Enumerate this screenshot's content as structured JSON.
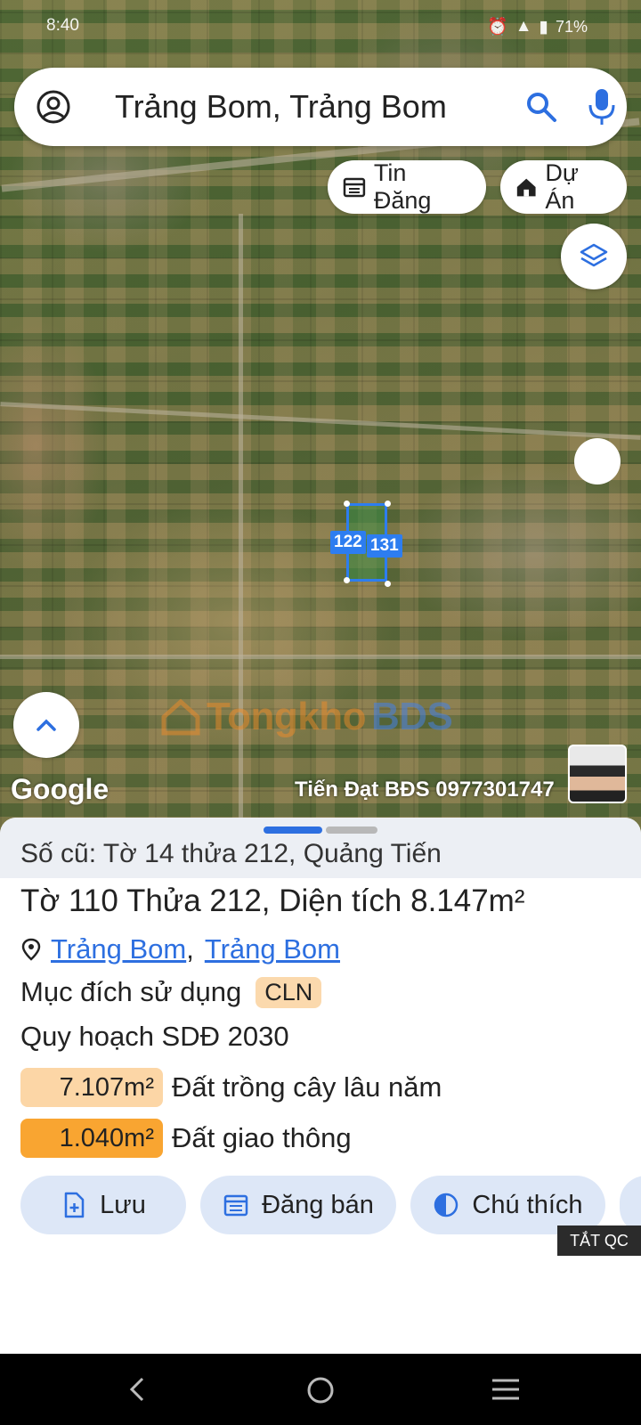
{
  "status_bar": {
    "time": "8:40",
    "battery": "71%"
  },
  "search": {
    "text": "Trảng Bom, Trảng Bom"
  },
  "chips": {
    "tin_dang": "Tin Đăng",
    "du_an": "Dự Án"
  },
  "map": {
    "parcel_labels": [
      "122",
      "131"
    ],
    "watermark_text": "Tongkho",
    "watermark_text_2": "BDS",
    "google_logo": "Google",
    "agent_name": "Tiến Đạt BĐS 0977301747"
  },
  "sheet": {
    "old_info": "Số cũ: Tờ 14 thửa 212, Quảng Tiến",
    "title": "Tờ 110 Thửa 212, Diện tích 8.147m²",
    "location": {
      "district": "Trảng Bom",
      "separator": ",",
      "town": "Trảng Bom"
    },
    "purpose_label": "Mục đích sử dụng",
    "purpose_code": "CLN",
    "planning": "Quy hoạch SDĐ 2030",
    "areas": [
      {
        "value": "7.107m²",
        "label": "Đất trồng cây lâu năm",
        "color": "#fcd6a6"
      },
      {
        "value": "1.040m²",
        "label": "Đất giao thông",
        "color": "#f9a531"
      }
    ],
    "actions": {
      "save": "Lưu",
      "post_sale": "Đăng bán",
      "legend": "Chú thích"
    },
    "ad_off": "TẮT QC"
  },
  "colors": {
    "accent": "#2d6fe0",
    "parcel": "#2d7df0",
    "button_bg": "#dde7f7"
  }
}
